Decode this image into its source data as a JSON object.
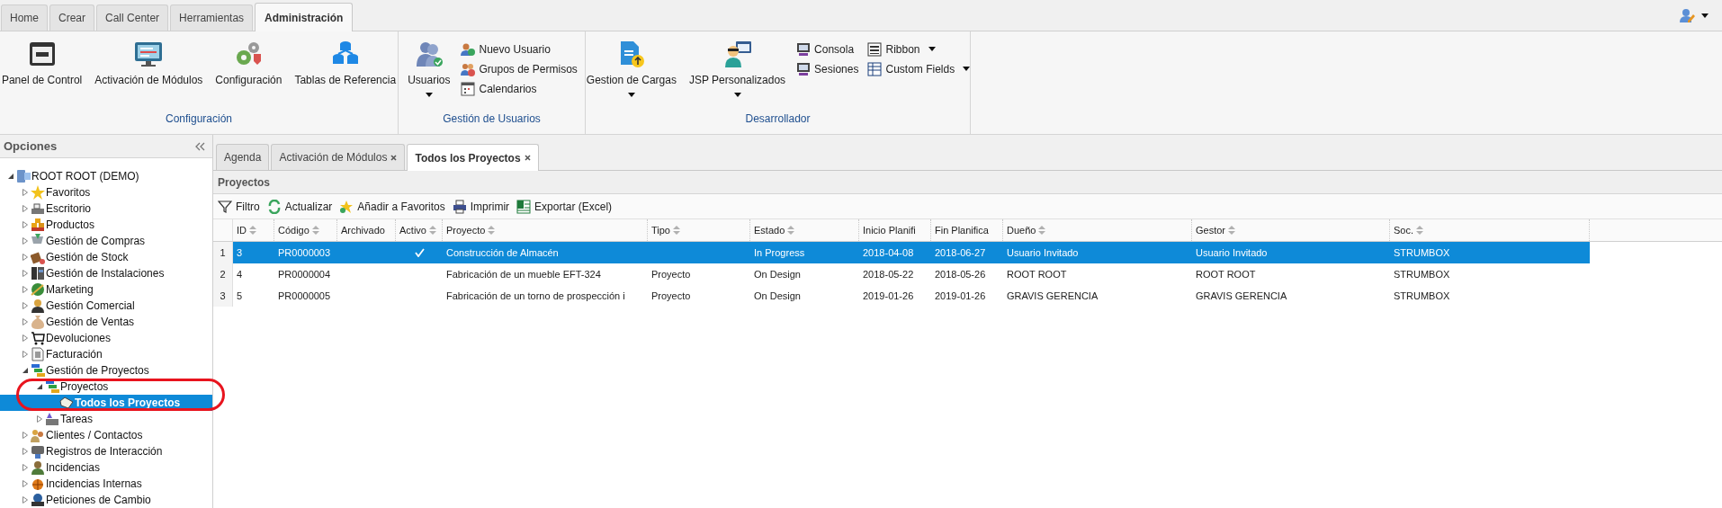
{
  "top_tabs": [
    {
      "label": "Home",
      "selected": false
    },
    {
      "label": "Crear",
      "selected": false
    },
    {
      "label": "Call Center",
      "selected": false
    },
    {
      "label": "Herramientas",
      "selected": false
    },
    {
      "label": "Administración",
      "selected": true
    }
  ],
  "ribbon": {
    "groups": [
      {
        "label": "Configuración",
        "items": [
          {
            "kind": "large",
            "label": "Panel de Control",
            "dropdown": false
          },
          {
            "kind": "large",
            "label": "Activación de Módulos",
            "dropdown": false
          },
          {
            "kind": "large",
            "label": "Configuración",
            "dropdown": false
          },
          {
            "kind": "large",
            "label": "Tablas de Referencia",
            "dropdown": false
          }
        ]
      },
      {
        "label": "Gestión de Usuarios",
        "items": [
          {
            "kind": "large",
            "label": "Usuarios",
            "dropdown": true
          },
          {
            "kind": "stack",
            "buttons": [
              {
                "label": "Nuevo Usuario",
                "dropdown": false
              },
              {
                "label": "Grupos de Permisos",
                "dropdown": false
              },
              {
                "label": "Calendarios",
                "dropdown": false
              }
            ]
          }
        ]
      },
      {
        "label": "Desarrollador",
        "items": [
          {
            "kind": "large",
            "label": "Gestion de Cargas",
            "dropdown": true
          },
          {
            "kind": "large",
            "label": "JSP Personalizados",
            "dropdown": true
          },
          {
            "kind": "stack",
            "buttons": [
              {
                "label": "Consola",
                "dropdown": false
              },
              {
                "label": "Sesiones",
                "dropdown": false
              }
            ]
          },
          {
            "kind": "stack",
            "buttons": [
              {
                "label": "Ribbon",
                "dropdown": true
              },
              {
                "label": "Custom Fields",
                "dropdown": true
              }
            ]
          }
        ]
      }
    ]
  },
  "sidebar": {
    "title": "Opciones",
    "tree": [
      {
        "label": "ROOT ROOT (DEMO)",
        "expanded": true,
        "selected": false,
        "children": [
          {
            "label": "Favoritos",
            "expanded": false,
            "selected": false
          },
          {
            "label": "Escritorio",
            "expanded": false,
            "selected": false
          },
          {
            "label": "Productos",
            "expanded": false,
            "selected": false
          },
          {
            "label": "Gestión de Compras",
            "expanded": false,
            "selected": false
          },
          {
            "label": "Gestión de Stock",
            "expanded": false,
            "selected": false
          },
          {
            "label": "Gestión de Instalaciones",
            "expanded": false,
            "selected": false
          },
          {
            "label": "Marketing",
            "expanded": false,
            "selected": false
          },
          {
            "label": "Gestión Comercial",
            "expanded": false,
            "selected": false
          },
          {
            "label": "Gestión de Ventas",
            "expanded": false,
            "selected": false
          },
          {
            "label": "Devoluciones",
            "expanded": false,
            "selected": false
          },
          {
            "label": "Facturación",
            "expanded": false,
            "selected": false
          },
          {
            "label": "Gestión de Proyectos",
            "expanded": true,
            "selected": false,
            "children": [
              {
                "label": "Proyectos",
                "expanded": true,
                "selected": false,
                "children": [
                  {
                    "label": "Todos los Proyectos",
                    "selected": true
                  }
                ]
              },
              {
                "label": "Tareas",
                "expanded": false,
                "selected": false
              }
            ]
          },
          {
            "label": "Clientes / Contactos",
            "expanded": false,
            "selected": false
          },
          {
            "label": "Registros de Interacción",
            "expanded": false,
            "selected": false
          },
          {
            "label": "Incidencias",
            "expanded": false,
            "selected": false
          },
          {
            "label": "Incidencias Internas",
            "expanded": false,
            "selected": false
          },
          {
            "label": "Peticiones de Cambio",
            "expanded": false,
            "selected": false
          }
        ]
      }
    ]
  },
  "content_tabs": [
    {
      "label": "Agenda",
      "closable": false,
      "selected": false
    },
    {
      "label": "Activación de Módulos",
      "closable": true,
      "selected": false
    },
    {
      "label": "Todos los Proyectos",
      "closable": true,
      "selected": true
    }
  ],
  "panel": {
    "title": "Proyectos",
    "toolbar": [
      "Filtro",
      "Actualizar",
      "Añadir a Favoritos",
      "Imprimir",
      "Exportar (Excel)"
    ],
    "table": {
      "columns": [
        {
          "label": "ID",
          "sortable": true
        },
        {
          "label": "Código",
          "sortable": true
        },
        {
          "label": "Archivado",
          "sortable": false
        },
        {
          "label": "Activo",
          "sortable": true
        },
        {
          "label": "Proyecto",
          "sortable": true
        },
        {
          "label": "Tipo",
          "sortable": true
        },
        {
          "label": "Estado",
          "sortable": true
        },
        {
          "label": "Inicio Planifi",
          "sortable": false
        },
        {
          "label": "Fin Planifica",
          "sortable": false
        },
        {
          "label": "Dueño",
          "sortable": true
        },
        {
          "label": "Gestor",
          "sortable": true
        },
        {
          "label": "Soc.",
          "sortable": true
        }
      ],
      "rows": [
        {
          "number": "1",
          "selected": true,
          "active": true,
          "id": "3",
          "code": "PR0000003",
          "project": "Construcción de Almacén",
          "status": "In Progress",
          "start": "2018-04-08",
          "end": "2018-06-27",
          "owner": "Usuario Invitado",
          "manager": "Usuario Invitado",
          "company": "STRUMBOX"
        },
        {
          "number": "2",
          "selected": false,
          "active": false,
          "id": "4",
          "code": "PR0000004",
          "project": "Fabricación de un mueble EFT-324",
          "type": "Proyecto",
          "status": "On Design",
          "start": "2018-05-22",
          "end": "2018-05-26",
          "owner": "ROOT ROOT",
          "manager": "ROOT ROOT",
          "company": "STRUMBOX"
        },
        {
          "number": "3",
          "selected": false,
          "active": false,
          "id": "5",
          "code": "PR0000005",
          "project": "Fabricación de un torno de prospección i",
          "type": "Proyecto",
          "status": "On Design",
          "start": "2019-01-26",
          "end": "2019-01-26",
          "owner": "GRAVIS GERENCIA",
          "manager": "GRAVIS GERENCIA",
          "company": "STRUMBOX"
        }
      ]
    }
  }
}
